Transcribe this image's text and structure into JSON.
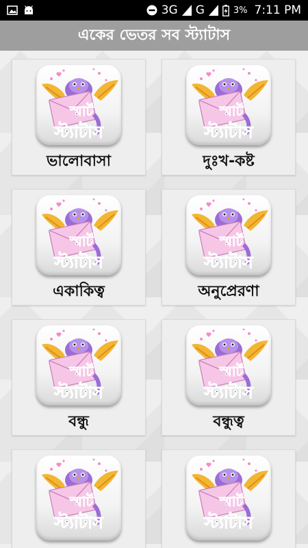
{
  "status_bar": {
    "network_3g": "3G",
    "network_g": "G",
    "battery_percent": "3%",
    "time": "7:11 PM"
  },
  "app": {
    "title": "একের ভেতর সব স্ট্যাটাস"
  },
  "icon_text": {
    "line1": "স্মার্ট",
    "line2": "স্ট্যাটাস"
  },
  "categories": [
    {
      "label": "ভালোবাসা"
    },
    {
      "label": "দুঃখ-কষ্ট"
    },
    {
      "label": "একাকিত্ব"
    },
    {
      "label": "অনুপ্রেরণা"
    },
    {
      "label": "বন্ধু"
    },
    {
      "label": "বন্ধুত্ব"
    },
    {
      "label": ""
    },
    {
      "label": ""
    }
  ],
  "colors": {
    "app_bar": "#9e9e9e",
    "status_bar": "#000000",
    "icon_text_blue": "#2f5fd0",
    "icon_text_purple": "#7b3fb8"
  }
}
